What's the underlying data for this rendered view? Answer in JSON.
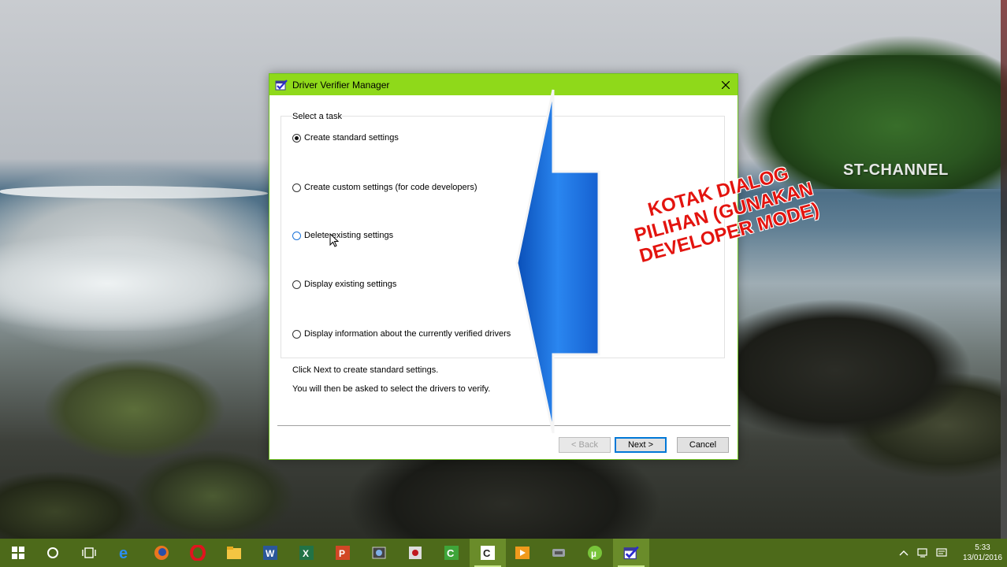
{
  "desktop": {
    "watermark": "ST-CHANNEL",
    "overlay_caption": [
      "KOTAK DIALOG",
      "PILIHAN (GUNAKAN",
      "DEVELOPER MODE)"
    ]
  },
  "dialog": {
    "title": "Driver Verifier Manager",
    "icon": "verifier-checkmark-icon",
    "group_label": "Select a task",
    "options": [
      {
        "label": "Create standard settings",
        "checked": true
      },
      {
        "label": "Create custom settings (for code developers)",
        "checked": false
      },
      {
        "label": "Delete existing settings",
        "checked": false
      },
      {
        "label": "Display existing settings",
        "checked": false
      },
      {
        "label": "Display information about the currently verified drivers",
        "checked": false
      }
    ],
    "description_1": "Click Next to create standard settings.",
    "description_2": "You will then be asked to select the drivers to verify.",
    "buttons": {
      "back": "< Back",
      "next": "Next >",
      "cancel": "Cancel"
    }
  },
  "taskbar": {
    "items": [
      "start-icon",
      "cortana-search-icon",
      "task-view-icon",
      "edge-icon",
      "firefox-icon",
      "opera-icon",
      "file-explorer-icon",
      "word-icon",
      "excel-icon",
      "powerpoint-icon",
      "camera-app-icon",
      "media-app-icon",
      "camtasia-icon",
      "camtasia-editor-icon",
      "video-player-icon",
      "network-app-icon",
      "utorrent-icon",
      "driver-verifier-icon"
    ],
    "clock_time": "5:33",
    "clock_date": "13/01/2016"
  },
  "colors": {
    "titlebar": "#8fd91a",
    "taskbar": "#4d6a1a",
    "arrow_blue": "#1a6fe0",
    "caption_red": "#e3140f"
  }
}
